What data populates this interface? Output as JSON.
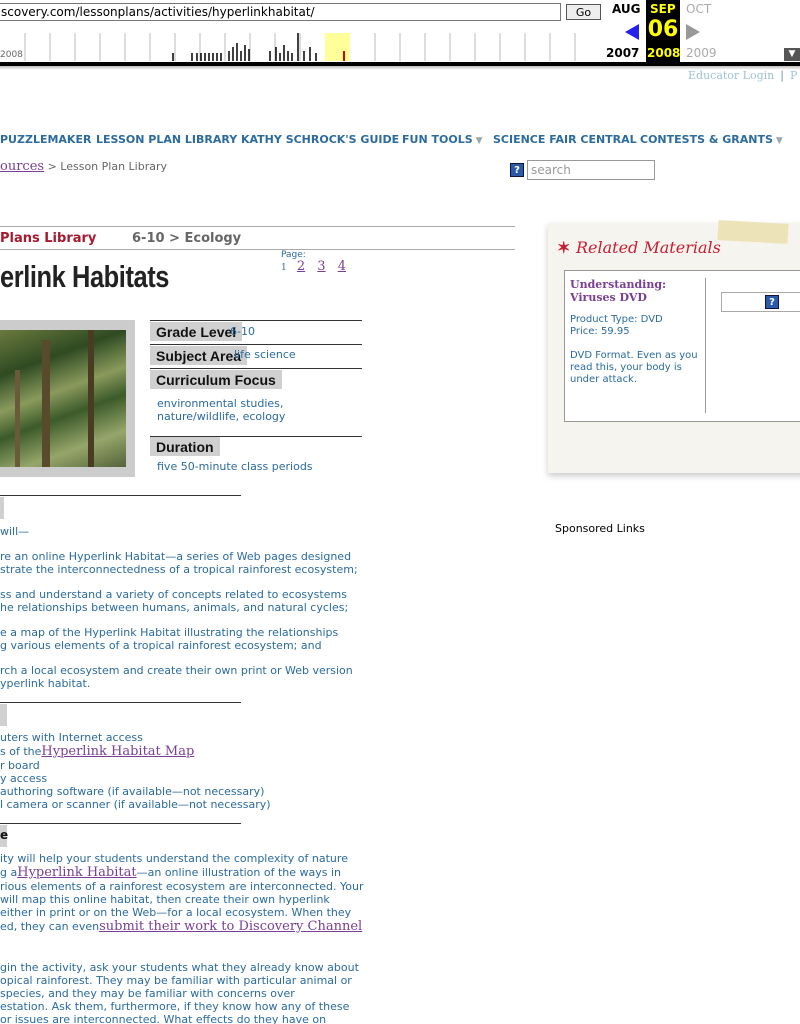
{
  "wayback": {
    "url": "scovery.com/lessonplans/activities/hyperlinkhabitat/",
    "go_label": "Go",
    "month_prev": "AUG",
    "month_cur": "SEP",
    "month_next": "OCT",
    "day": "06",
    "year_prev": "2007",
    "year_cur": "2008",
    "year_next": "2009",
    "left_year": "2008",
    "close_label": "▼"
  },
  "header": {
    "login": "Educator Login",
    "login_sep": "|",
    "login_more": "P"
  },
  "nav": {
    "items": [
      {
        "label": "PUZZLEMAKER"
      },
      {
        "label": "LESSON PLAN LIBRARY"
      },
      {
        "label": "KATHY SCHROCK'S GUIDE"
      },
      {
        "label": "FUN TOOLS",
        "arrow": "▼"
      },
      {
        "label": "SCIENCE FAIR CENTRAL"
      },
      {
        "label": "CONTESTS & GRANTS",
        "arrow": "▼"
      }
    ]
  },
  "breadcrumb": {
    "link": "ources",
    "sep": ">",
    "current": "Lesson Plan Library"
  },
  "search": {
    "help": "?",
    "placeholder": "search"
  },
  "section": {
    "library": "Plans Library",
    "sub": "6-10 > Ecology"
  },
  "title": "erlink Habitats",
  "pager": {
    "label": "Page:",
    "current": "1",
    "pages": [
      "2",
      "3",
      "4"
    ]
  },
  "info": {
    "grade_label": "Grade Level",
    "grade_value": "6-10",
    "subject_label": "Subject Area",
    "subject_value": "life science",
    "curriculum_label": "Curriculum Focus",
    "curriculum_lines": [
      "environmental studies,",
      "nature/wildlife, ecology"
    ],
    "duration_label": "Duration",
    "duration_value": "five 50-minute class periods"
  },
  "objectives": {
    "intro": "will—",
    "items": [
      [
        "re an online Hyperlink Habitat—a series of Web pages designed",
        "strate the interconnectedness of a tropical rainforest ecosystem;"
      ],
      [
        "ss and understand a variety of concepts related to ecosystems",
        "he relationships between humans, animals, and natural cycles;"
      ],
      [
        "e a map of the Hyperlink Habitat illustrating the relationships",
        "g various elements of a tropical rainforest ecosystem; and"
      ],
      [
        "rch a local ecosystem and create their own print or Web version",
        "yperlink habitat."
      ]
    ]
  },
  "materials": {
    "line1": "uters with Internet access",
    "line2_pre": "s of the",
    "line2_link": "Hyperlink Habitat Map",
    "line3": "r board",
    "line4": "y access",
    "line5": "authoring software (if available—not necessary)",
    "line6": "l camera or scanner (if available—not necessary)"
  },
  "procedure": {
    "tab_label": "e",
    "p1_line1": "ity will help your students understand the complexity of nature",
    "p1_line2_pre": "g a",
    "p1_line2_link": "Hyperlink Habitat",
    "p1_line2_post": "—an online illustration of the ways in",
    "p1_line3": "rious elements of a rainforest ecosystem are interconnected. Your",
    "p1_line4": "will map this online habitat, then create their own hyperlink",
    "p1_line5": "either in print or on the Web—for a local ecosystem. When they",
    "p1_line6_pre": "ed, they can even",
    "p1_line6_link": "submit their work to Discovery Channel",
    "p2_lines": [
      "gin the activity, ask your students what they already know about",
      "opical rainforest. They may be familiar with particular animal or",
      "species, and they may be familiar with concerns over",
      "estation. Ask them, furthermore, if they know how any of these",
      "or issues are interconnected. What effects do they have on"
    ]
  },
  "related": {
    "title": "Related Materials",
    "product_title_lines": [
      "Understanding:",
      "Viruses DVD"
    ],
    "product_type": "Product Type: DVD",
    "price": "Price: 59.95",
    "desc_lines": [
      "DVD Format. Even as you",
      "read this, your body is",
      "under attack."
    ],
    "help": "?"
  },
  "sponsored": "Sponsored Links",
  "colors": {
    "link_blue": "#2b6b9e",
    "visited_purple": "#7a3e97",
    "accent_red": "#a6192e",
    "wayback_yellow": "#ffff00"
  }
}
